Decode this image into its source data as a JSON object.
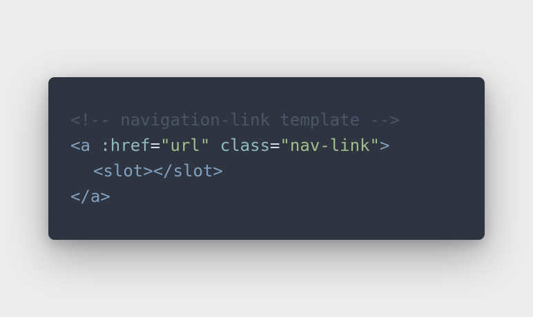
{
  "colors": {
    "page_background": "#ececec",
    "card_background": "#2e3440",
    "comment": "#4c566a",
    "tag": "#81a1c1",
    "attribute": "#8fbcbb",
    "punctuation": "#d8dee9",
    "string": "#a3be8c"
  },
  "code": {
    "line1": {
      "comment": "<!-- navigation-link template -->"
    },
    "line2": {
      "open": "<a",
      "attr1": ":href",
      "eq1": "=",
      "val1": "\"url\"",
      "attr2": "class",
      "eq2": "=",
      "val2": "\"nav-link\"",
      "close": ">"
    },
    "line3": {
      "slot_open": "<slot>",
      "slot_close": "</slot>"
    },
    "line4": {
      "close_tag": "</a>"
    }
  }
}
